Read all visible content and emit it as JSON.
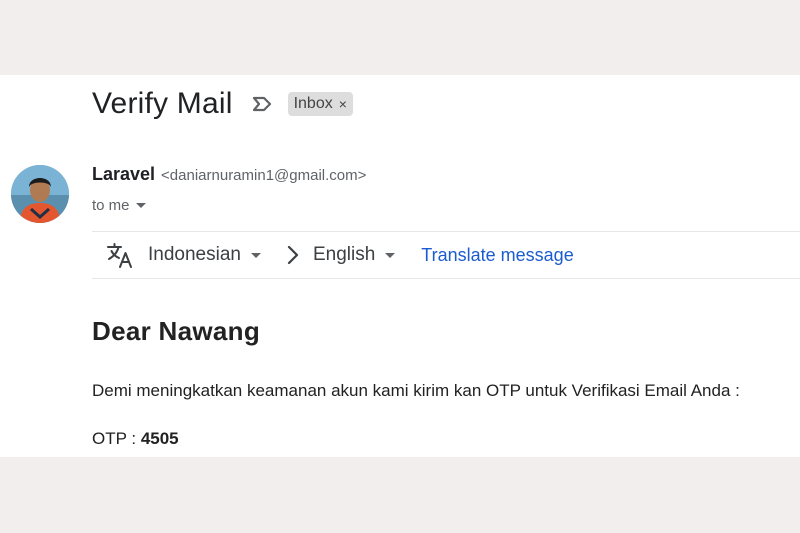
{
  "email": {
    "subject": "Verify Mail",
    "label": "Inbox",
    "label_remove": "×",
    "sender": {
      "name": "Laravel",
      "email": "<daniarnuramin1@gmail.com>"
    },
    "recipient_text": "to me"
  },
  "translate_bar": {
    "source_language": "Indonesian",
    "target_language": "English",
    "action_label": "Translate message"
  },
  "message": {
    "greeting": "Dear Nawang",
    "paragraph": "Demi meningkatkan keamanan akun kami kirim kan OTP untuk Verifikasi Email Anda :",
    "otp_label": "OTP : ",
    "otp_value": "4505"
  },
  "colors": {
    "background_outer": "#f1eeed",
    "link_blue": "#1a5ccf",
    "chip_gray": "#dddddd"
  },
  "icons": [
    "important-marker-icon",
    "translate-icon",
    "chevron-right-icon",
    "dropdown-caret-icon"
  ]
}
